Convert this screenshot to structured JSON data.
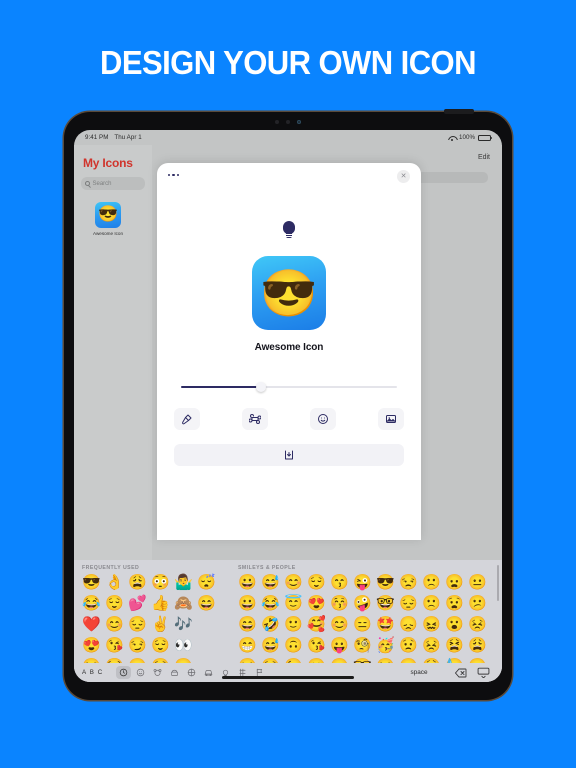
{
  "headline": "DESIGN YOUR OWN ICON",
  "theme": {
    "background": "#0a84ff",
    "accent_navy": "#2d2b63",
    "title_red": "#d0342c",
    "sheet_white": "#ffffff",
    "dim_gray": "#c3c5c5"
  },
  "status_bar": {
    "time": "9:41 PM",
    "date": "Thu Apr 1",
    "battery_percent": "100%",
    "wifi_icon": "wifi-icon",
    "battery_icon": "battery-icon"
  },
  "sidebar": {
    "title": "My Icons",
    "search_placeholder": "Search",
    "search_icon": "search-icon",
    "items": [
      {
        "label": "Awesome Icon",
        "emoji": "😎"
      }
    ]
  },
  "content": {
    "edit_label": "Edit"
  },
  "modal": {
    "menu_icon": "ellipsis-icon",
    "close_label": "✕",
    "close_icon": "close-icon",
    "logo_icon": "lightbulb-icon",
    "preview": {
      "emoji": "😎",
      "name": "Awesome Icon"
    },
    "slider": {
      "value_percent": 37,
      "label": "corner-radius-slider"
    },
    "tools": [
      {
        "name": "paint-roller-icon",
        "label": "Background"
      },
      {
        "name": "command-icon",
        "label": "Symbol"
      },
      {
        "name": "emoji-icon",
        "label": "Emoji"
      },
      {
        "name": "photo-icon",
        "label": "Photo"
      }
    ],
    "save": {
      "icon": "download-tray-icon",
      "label": "Save"
    }
  },
  "keyboard": {
    "sections": [
      {
        "title": "FREQUENTLY USED",
        "columns": 6,
        "emojis": [
          "😎",
          "👌",
          "😩",
          "😳",
          "🤷‍♂️",
          "😴",
          "😂",
          "😌",
          "💕",
          "👍",
          "🙈",
          "😄",
          "❤️",
          "😊",
          "😔",
          "✌️",
          "🎶",
          "",
          "😍",
          "😘",
          "😏",
          "😌",
          "👀",
          "",
          "😒",
          "😭",
          "😁",
          "😌",
          "😑",
          ""
        ]
      },
      {
        "title": "SMILEYS & PEOPLE",
        "columns": 11,
        "emojis": [
          "😀",
          "😅",
          "😊",
          "😌",
          "😙",
          "😜",
          "😎",
          "😒",
          "🙁",
          "😦",
          "😐",
          "😀",
          "😂",
          "😇",
          "😍",
          "😚",
          "🤪",
          "🤓",
          "😔",
          "🙁",
          "😧",
          "😕",
          "😄",
          "🤣",
          "🙂",
          "🥰",
          "😊",
          "😑",
          "🤩",
          "😞",
          "😖",
          "😮",
          "😣",
          "😁",
          "😅",
          "🙃",
          "😘",
          "😛",
          "🧐",
          "🥳",
          "😟",
          "😣",
          "😫",
          "😩",
          "😆",
          "😌",
          "😉",
          "😗",
          "😝",
          "🤓",
          "😒",
          "😐",
          "😫",
          "😓",
          "😖"
        ]
      }
    ],
    "bottom_bar": {
      "abc_label": "A B C",
      "space_label": "space",
      "categories": [
        {
          "name": "recents-icon",
          "active": true
        },
        {
          "name": "smileys-icon",
          "active": false
        },
        {
          "name": "animals-icon",
          "active": false
        },
        {
          "name": "food-icon",
          "active": false
        },
        {
          "name": "activity-icon",
          "active": false
        },
        {
          "name": "travel-icon",
          "active": false
        },
        {
          "name": "objects-icon",
          "active": false
        },
        {
          "name": "symbols-icon",
          "active": false
        },
        {
          "name": "flags-icon",
          "active": false
        }
      ],
      "delete_icon": "delete-backward-icon",
      "dismiss_icon": "keyboard-dismiss-icon"
    }
  }
}
